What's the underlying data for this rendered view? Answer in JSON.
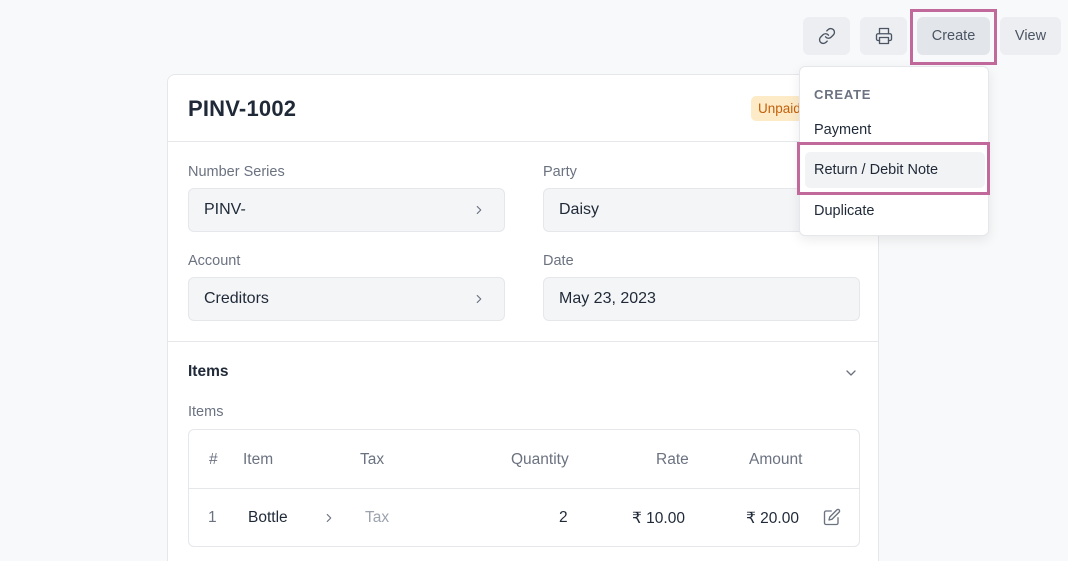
{
  "toolbar": {
    "link_icon": "link-icon",
    "print_icon": "printer-icon",
    "create_label": "Create",
    "view_label": "View"
  },
  "document": {
    "title": "PINV-1002",
    "status": "Unpaid",
    "status_color": "#c2610c"
  },
  "fields": {
    "number_series": {
      "label": "Number Series",
      "value": "PINV-"
    },
    "party": {
      "label": "Party",
      "value": "Daisy"
    },
    "account": {
      "label": "Account",
      "value": "Creditors"
    },
    "date": {
      "label": "Date",
      "value": "May 23, 2023"
    }
  },
  "items_section": {
    "title": "Items",
    "table_label": "Items",
    "columns": [
      "#",
      "Item",
      "Tax",
      "Quantity",
      "Rate",
      "Amount"
    ],
    "rows": [
      {
        "index": "1",
        "item": "Bottle",
        "tax": "Tax",
        "quantity": "2",
        "rate": "₹ 10.00",
        "amount": "₹ 20.00"
      }
    ]
  },
  "create_menu": {
    "header": "CREATE",
    "items": [
      "Payment",
      "Return / Debit Note",
      "Duplicate"
    ]
  },
  "highlight_color": "#c2699b"
}
